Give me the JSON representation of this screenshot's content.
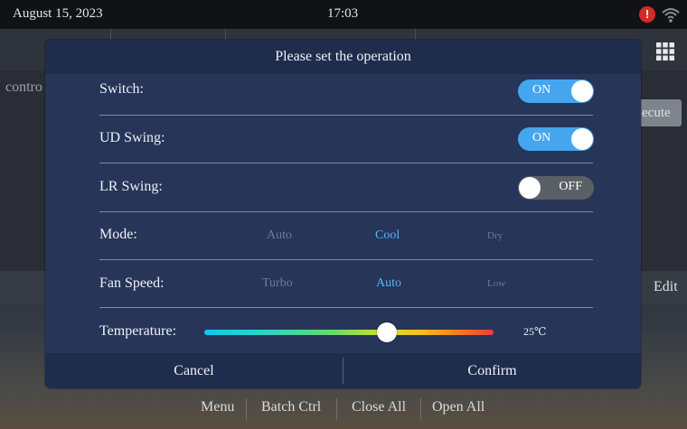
{
  "status_bar": {
    "date": "August 15, 2023",
    "time": "17:03",
    "alert_icon": "alert-icon",
    "wifi_icon": "wifi-icon"
  },
  "background": {
    "control_label": "contro",
    "execute_label": "ecute",
    "edit_label": "Edit",
    "grid_icon": "grid-icon"
  },
  "bottom_nav": [
    "Menu",
    "Batch Ctrl",
    "Close All",
    "Open All"
  ],
  "dialog": {
    "title": "Please set the operation",
    "switch": {
      "label": "Switch:",
      "state": "ON"
    },
    "ud_swing": {
      "label": "UD Swing:",
      "state": "ON"
    },
    "lr_swing": {
      "label": "LR Swing:",
      "state": "OFF"
    },
    "mode": {
      "label": "Mode:",
      "options": [
        "Auto",
        "Cool",
        "Dry"
      ],
      "selected": "Cool"
    },
    "fan_speed": {
      "label": "Fan Speed:",
      "options": [
        "Turbo",
        "Auto",
        "Low"
      ],
      "selected": "Auto"
    },
    "temperature": {
      "label": "Temperature:",
      "value": "25℃",
      "level_fraction": 0.63
    },
    "cancel_label": "Cancel",
    "confirm_label": "Confirm"
  },
  "colors": {
    "accent": "#45a6ef",
    "selected_option": "#58b4ff",
    "dialog_bg": "#263558",
    "alert": "#d42a2a"
  }
}
